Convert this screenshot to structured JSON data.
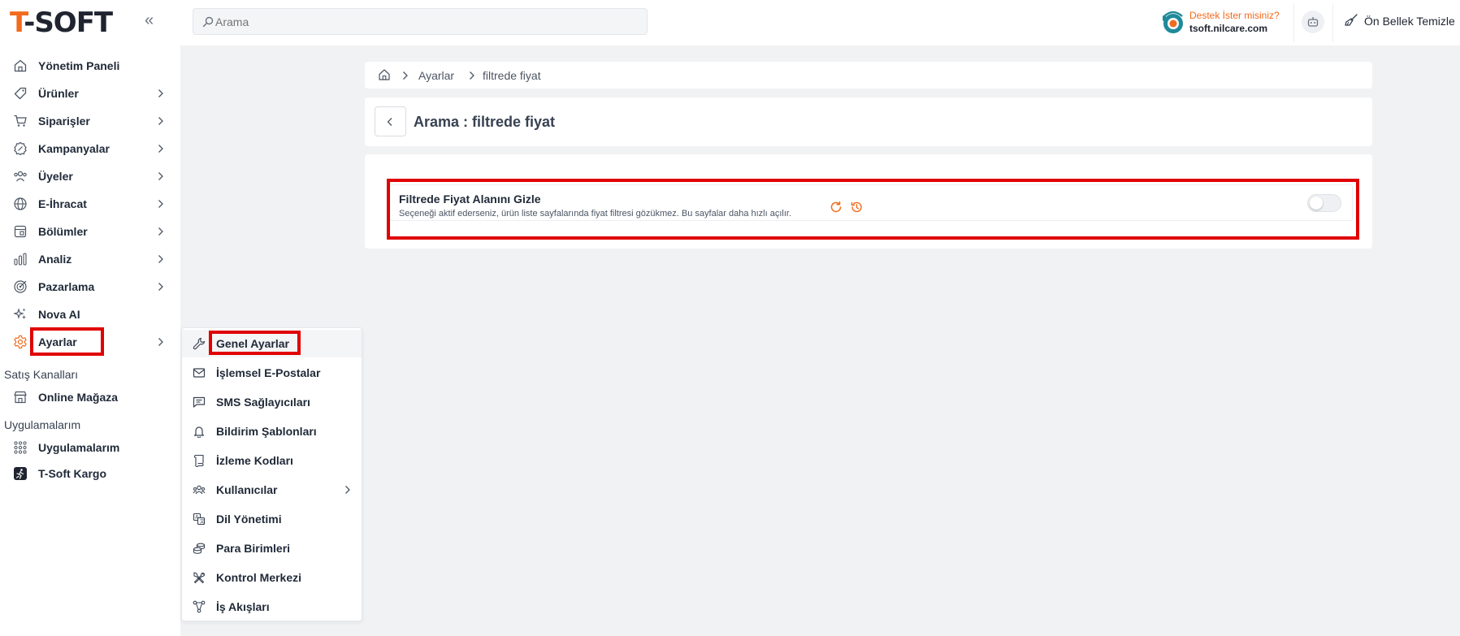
{
  "brand": {
    "logo_t": "T",
    "logo_rest": "-SOFT",
    "accent_color": "#f26b1d"
  },
  "header": {
    "search_placeholder": "Arama",
    "support_title": "Destek İster misiniz?",
    "support_url": "tsoft.nilcare.com",
    "cache_label": "Ön Bellek Temizle"
  },
  "sidebar": {
    "items": [
      {
        "label": "Yönetim Paneli",
        "icon": "home-icon",
        "has_children": false
      },
      {
        "label": "Ürünler",
        "icon": "tag-icon",
        "has_children": true
      },
      {
        "label": "Siparişler",
        "icon": "cart-icon",
        "has_children": true
      },
      {
        "label": "Kampanyalar",
        "icon": "discount-icon",
        "has_children": true
      },
      {
        "label": "Üyeler",
        "icon": "users-icon",
        "has_children": true
      },
      {
        "label": "E-İhracat",
        "icon": "globe-icon",
        "has_children": true
      },
      {
        "label": "Bölümler",
        "icon": "layout-icon",
        "has_children": true
      },
      {
        "label": "Analiz",
        "icon": "analytics-icon",
        "has_children": true
      },
      {
        "label": "Pazarlama",
        "icon": "target-icon",
        "has_children": true
      },
      {
        "label": "Nova AI",
        "icon": "sparkle-icon",
        "has_children": false
      },
      {
        "label": "Ayarlar",
        "icon": "gear-icon",
        "has_children": true,
        "active": true
      }
    ],
    "section_sales": "Satış Kanalları",
    "online_store": "Online Mağaza",
    "section_apps": "Uygulamalarım",
    "apps": "Uygulamalarım",
    "kargo": "T-Soft Kargo"
  },
  "submenu": {
    "items": [
      {
        "label": "Genel Ayarlar",
        "icon": "wrench-icon"
      },
      {
        "label": "İşlemsel E-Postalar",
        "icon": "mail-icon"
      },
      {
        "label": "SMS Sağlayıcıları",
        "icon": "message-icon"
      },
      {
        "label": "Bildirim Şablonları",
        "icon": "bell-icon"
      },
      {
        "label": "İzleme Kodları",
        "icon": "script-icon"
      },
      {
        "label": "Kullanıcılar",
        "icon": "users-group-icon",
        "has_children": true
      },
      {
        "label": "Dil Yönetimi",
        "icon": "language-icon"
      },
      {
        "label": "Para Birimleri",
        "icon": "coins-icon"
      },
      {
        "label": "Kontrol Merkezi",
        "icon": "tools-icon"
      },
      {
        "label": "İş Akışları",
        "icon": "workflow-icon"
      }
    ]
  },
  "breadcrumb": {
    "level1": "Ayarlar",
    "level2": "filtrede fiyat"
  },
  "page": {
    "title": "Arama : filtrede fiyat"
  },
  "setting": {
    "title": "Filtrede Fiyat Alanını Gizle",
    "description": "Seçeneği aktif ederseniz, ürün liste sayfalarında fiyat filtresi gözükmez. Bu sayfalar daha hızlı açılır.",
    "enabled": false
  }
}
